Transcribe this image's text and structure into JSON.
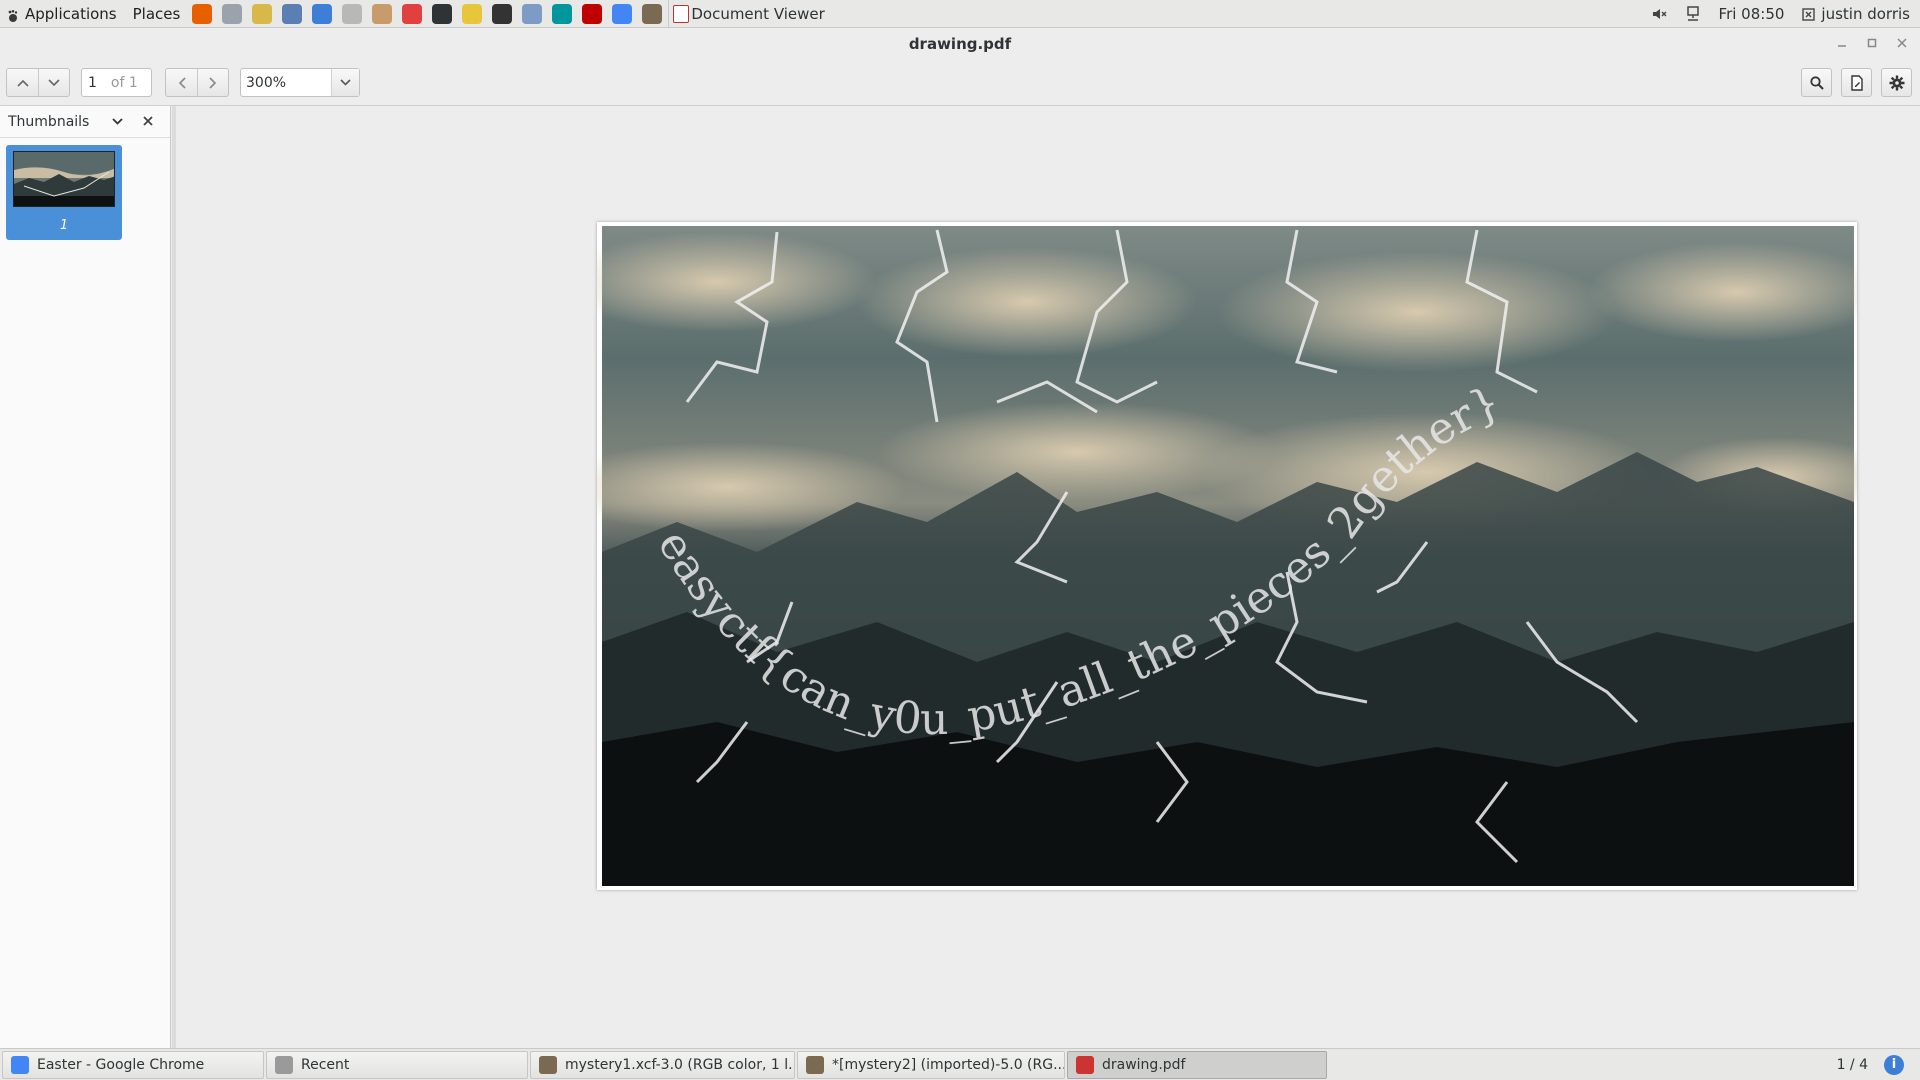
{
  "top_panel": {
    "applications_label": "Applications",
    "places_label": "Places",
    "launchers": [
      {
        "icon": "firefox-icon",
        "color": "#e66000"
      },
      {
        "icon": "network-icon",
        "color": "#9aa3ab"
      },
      {
        "icon": "disk-icon",
        "color": "#d9b84a"
      },
      {
        "icon": "system-monitor-icon",
        "color": "#5b7fb3"
      },
      {
        "icon": "document-icon",
        "color": "#3d7fd6"
      },
      {
        "icon": "printer-icon",
        "color": "#b8b8b8"
      },
      {
        "icon": "archive-icon",
        "color": "#c89c6a"
      },
      {
        "icon": "help-lifebuoy-icon",
        "color": "#e04040"
      },
      {
        "icon": "terminal-icon",
        "color": "#2e3436"
      },
      {
        "icon": "tweak-icon",
        "color": "#e7c63b"
      },
      {
        "icon": "inkscape-icon",
        "color": "#333333"
      },
      {
        "icon": "text-editor-icon",
        "color": "#7c9cc5"
      },
      {
        "icon": "arduino-icon",
        "color": "#00979c"
      },
      {
        "icon": "filezilla-icon",
        "color": "#bf0000"
      },
      {
        "icon": "chrome-icon",
        "color": "#4285f4"
      },
      {
        "icon": "gimp-icon",
        "color": "#7a6a52"
      }
    ],
    "active_window": "Document Viewer",
    "volume_icon": "volume-muted-icon",
    "network_icon": "wired-network-icon",
    "clock": "Fri 08:50",
    "user": "justin dorris"
  },
  "window": {
    "title": "drawing.pdf"
  },
  "toolbar": {
    "page_current": "1",
    "page_total": "of 1",
    "zoom": "300%"
  },
  "sidebar": {
    "mode_label": "Thumbnails",
    "thumbnail_page": "1"
  },
  "document": {
    "overlay_text": "easyctf{can_y0u_put_all_the_pieces_2gether}",
    "colors": {
      "sky": "#5d6f6e",
      "cloud": "#cbbda3",
      "mountain": "#303b3b",
      "ground": "#0d1010"
    }
  },
  "taskbar": {
    "tasks": [
      {
        "label": "Easter - Google Chrome",
        "icon": "chrome-icon",
        "color": "#4285f4"
      },
      {
        "label": "Recent",
        "icon": "file-manager-icon",
        "color": "#9a9a9a"
      },
      {
        "label": "mystery1.xcf-3.0 (RGB color, 1 l...",
        "icon": "gimp-icon",
        "color": "#7a6a52"
      },
      {
        "label": "*[mystery2] (imported)-5.0 (RG...",
        "icon": "gimp-icon",
        "color": "#7a6a52"
      },
      {
        "label": "drawing.pdf",
        "icon": "pdf-icon",
        "color": "#cc3333"
      }
    ],
    "workspace": "1 / 4"
  }
}
